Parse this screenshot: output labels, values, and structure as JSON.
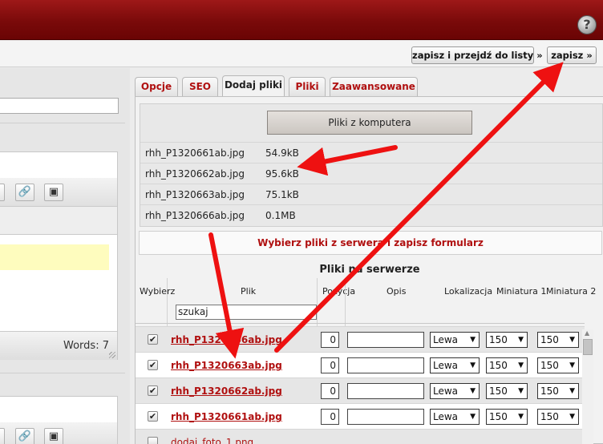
{
  "header": {
    "help_label": "?"
  },
  "toolbar": {
    "save_and_list_label": "zapisz i przejdź do listy »",
    "save_label": "zapisz »"
  },
  "editor": {
    "words_label": "Words: 7"
  },
  "tabs": [
    {
      "label": "Opcje"
    },
    {
      "label": "SEO"
    },
    {
      "label": "Dodaj pliki",
      "active": true
    },
    {
      "label": "Pliki"
    },
    {
      "label": "Zaawansowane"
    }
  ],
  "upload": {
    "button_label": "Pliki z komputera",
    "files": [
      {
        "name": "rhh_P1320661ab.jpg",
        "size": "54.9kB"
      },
      {
        "name": "rhh_P1320662ab.jpg",
        "size": "95.6kB"
      },
      {
        "name": "rhh_P1320663ab.jpg",
        "size": "75.1kB"
      },
      {
        "name": "rhh_P1320666ab.jpg",
        "size": "0.1MB"
      }
    ]
  },
  "server": {
    "choose_label": "Wybierz pliki z serwera i zapisz formularz",
    "title": "Pliki na serwerze",
    "columns": [
      "Wybierz",
      "Plik",
      "Pozycja",
      "Opis",
      "Lokalizacja",
      "Miniatura 1",
      "Miniatura 2"
    ],
    "search_value": "szukaj",
    "rows": [
      {
        "checked": "✔",
        "file": "rhh_P1320666ab.jpg",
        "position": "0",
        "location": "Lewa",
        "thumb1": "150",
        "thumb2": "150"
      },
      {
        "checked": "✔",
        "file": "rhh_P1320663ab.jpg",
        "position": "0",
        "location": "Lewa",
        "thumb1": "150",
        "thumb2": "150"
      },
      {
        "checked": "✔",
        "file": "rhh_P1320662ab.jpg",
        "position": "0",
        "location": "Lewa",
        "thumb1": "150",
        "thumb2": "150"
      },
      {
        "checked": "✔",
        "file": "rhh_P1320661ab.jpg",
        "position": "0",
        "location": "Lewa",
        "thumb1": "150",
        "thumb2": "150"
      },
      {
        "checked": "",
        "file": "dodaj_foto_1.png"
      }
    ]
  },
  "colors": {
    "header": "#7a0a0a",
    "link": "#b01010",
    "annotation_arrow": "#ee1111"
  }
}
